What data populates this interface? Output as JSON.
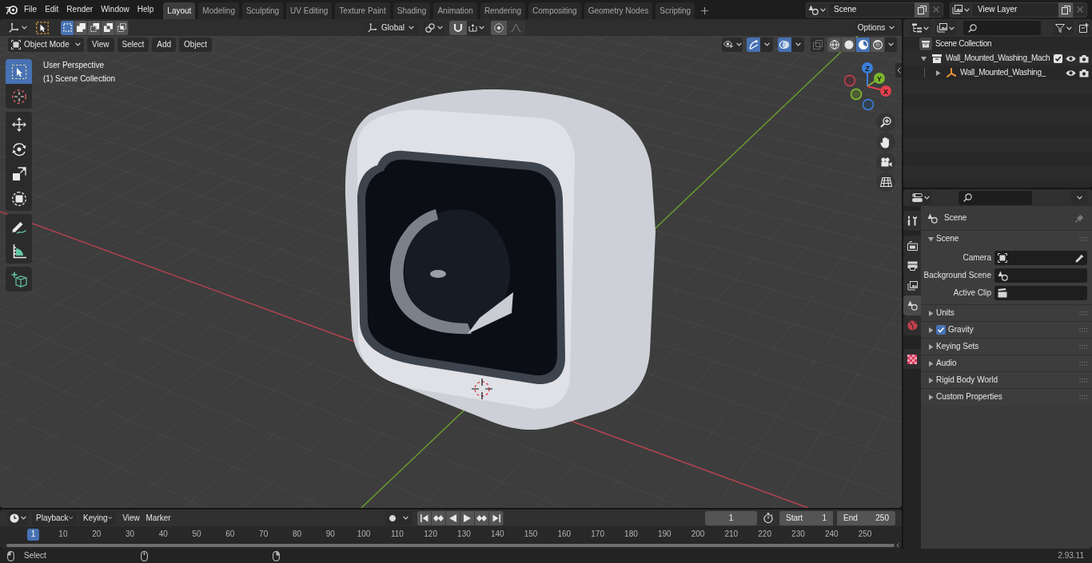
{
  "top_bar": {
    "menus": [
      "File",
      "Edit",
      "Render",
      "Window",
      "Help"
    ],
    "workspace_tabs": [
      {
        "label": "Layout",
        "selected": true
      },
      {
        "label": "Modeling",
        "selected": false
      },
      {
        "label": "Sculpting",
        "selected": false
      },
      {
        "label": "UV Editing",
        "selected": false
      },
      {
        "label": "Texture Paint",
        "selected": false
      },
      {
        "label": "Shading",
        "selected": false
      },
      {
        "label": "Animation",
        "selected": false
      },
      {
        "label": "Rendering",
        "selected": false
      },
      {
        "label": "Compositing",
        "selected": false
      },
      {
        "label": "Geometry Nodes",
        "selected": false
      },
      {
        "label": "Scripting",
        "selected": false
      }
    ],
    "scene": {
      "value": "Scene"
    },
    "view_layer": {
      "value": "View Layer"
    }
  },
  "viewport": {
    "header": {
      "select_modes": [
        {
          "kind": "new",
          "selected": true
        },
        {
          "kind": "extend",
          "selected": false
        },
        {
          "kind": "subtract",
          "selected": false
        },
        {
          "kind": "invert",
          "selected": false
        },
        {
          "kind": "intersect",
          "selected": false
        }
      ],
      "transform_orientation": "Global",
      "snap": {
        "on": false
      },
      "proportional_editing": {
        "on": false
      },
      "options": "Options",
      "mode": "Object Mode",
      "menus": [
        "View",
        "Select",
        "Add",
        "Object"
      ],
      "toggles": [
        {
          "kind": "gizmos",
          "on": true
        },
        {
          "kind": "overlays",
          "on": true
        },
        {
          "kind": "xray",
          "on": false
        }
      ],
      "shading_modes": [
        {
          "kind": "wireframe",
          "selected": false
        },
        {
          "kind": "solid",
          "selected": false
        },
        {
          "kind": "material",
          "selected": true
        },
        {
          "kind": "rendered",
          "selected": false
        }
      ]
    },
    "overlay_text": [
      "User Perspective",
      "(1) Scene Collection"
    ],
    "tool_groups": [
      {
        "tools": [
          {
            "kind": "select_box",
            "selected": true
          },
          {
            "kind": "cursor",
            "selected": false
          }
        ]
      },
      {
        "tools": [
          {
            "kind": "move",
            "selected": false
          },
          {
            "kind": "rotate",
            "selected": false
          },
          {
            "kind": "scale",
            "selected": false
          },
          {
            "kind": "transform",
            "selected": false
          }
        ]
      },
      {
        "tools": [
          {
            "kind": "annotate",
            "selected": false
          },
          {
            "kind": "measure",
            "selected": false
          }
        ]
      },
      {
        "tools": [
          {
            "kind": "add_cube",
            "selected": false
          }
        ]
      }
    ],
    "gizmo_axes": [
      "Z",
      "Y",
      "X"
    ]
  },
  "timeline": {
    "dropdowns": [
      "Playback",
      "Keying"
    ],
    "menus": [
      "View",
      "Marker"
    ],
    "auto_keying": {
      "on": false
    },
    "current_frame": "1",
    "start": {
      "label": "Start",
      "value": "1"
    },
    "end": {
      "label": "End",
      "value": "250"
    },
    "playhead": "1",
    "ruler": [
      "10",
      "20",
      "30",
      "40",
      "50",
      "60",
      "70",
      "80",
      "90",
      "100",
      "110",
      "120",
      "130",
      "140",
      "150",
      "160",
      "170",
      "180",
      "190",
      "200",
      "210",
      "220",
      "230",
      "240",
      "250"
    ]
  },
  "outliner": {
    "root": {
      "label": "Scene Collection",
      "kind": "scene_collection",
      "children": [
        {
          "label": "Wall_Mounted_Washing_Mach",
          "kind": "collection",
          "expanded": true,
          "checked": true,
          "children": [
            {
              "label": "Wall_Mounted_Washing_",
              "kind": "empty",
              "expanded": false
            }
          ]
        }
      ]
    }
  },
  "properties": {
    "tab_groups": [
      {
        "tabs": [
          {
            "kind": "tool",
            "selected": false
          }
        ]
      },
      {
        "tabs": [
          {
            "kind": "render",
            "selected": false
          },
          {
            "kind": "output",
            "selected": false
          },
          {
            "kind": "view_layer",
            "selected": false
          },
          {
            "kind": "scene",
            "selected": true
          },
          {
            "kind": "world",
            "selected": false
          }
        ]
      },
      {
        "tabs": [
          {
            "kind": "texture",
            "selected": false
          }
        ]
      }
    ],
    "context": "Scene",
    "panels": [
      {
        "title": "Scene",
        "kind": "panel",
        "expanded": true,
        "fields": [
          {
            "label": "Camera",
            "kind": "object"
          },
          {
            "label": "Background Scene",
            "kind": "scene"
          },
          {
            "label": "Active Clip",
            "kind": "clip"
          }
        ]
      },
      {
        "title": "Units",
        "kind": "panel",
        "expanded": false
      },
      {
        "title": "Gravity",
        "kind": "toggle_panel",
        "expanded": false,
        "checked": true
      },
      {
        "title": "Keying Sets",
        "kind": "panel",
        "expanded": false
      },
      {
        "title": "Audio",
        "kind": "panel",
        "expanded": false
      },
      {
        "title": "Rigid Body World",
        "kind": "panel",
        "expanded": false
      },
      {
        "title": "Custom Properties",
        "kind": "panel",
        "expanded": false
      }
    ]
  },
  "status_bar": {
    "action": "Select",
    "version": "2.93.11"
  }
}
